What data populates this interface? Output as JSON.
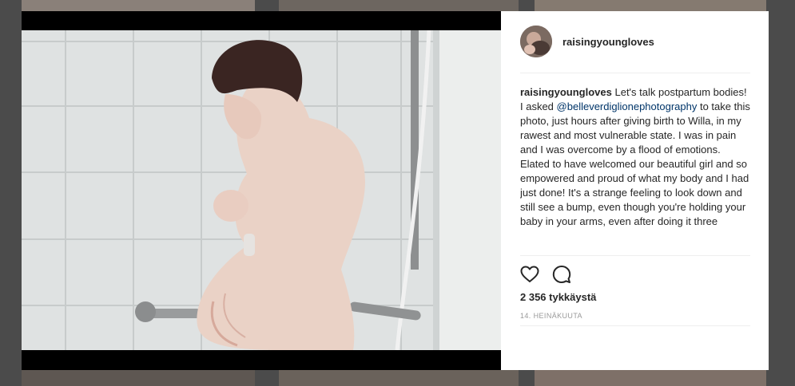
{
  "post": {
    "username": "raisingyoungloves",
    "caption": {
      "username": "raisingyoungloves",
      "text_before_mention": " Let's talk postpartum bodies! I asked ",
      "mention": "@belleverdiglionephotography",
      "text_after_mention": " to take this photo, just hours after giving birth to Willa, in my rawest and most vulnerable state. I was in pain and I was overcome by a flood of emotions. Elated to have welcomed our beautiful girl and so empowered and proud of what my body and I had just done! It's a strange feeling to look down and still see a bump, even though you're holding your baby in your arms, even after doing it three"
    },
    "likes": "2 356 tykkäystä",
    "date": "14. HEINÄKUUTA"
  },
  "icons": {
    "like": "heart-icon",
    "comment": "comment-icon"
  },
  "colors": {
    "link": "#003569",
    "text": "#262626",
    "muted": "#999999",
    "overlay": "#4b4b4b"
  }
}
